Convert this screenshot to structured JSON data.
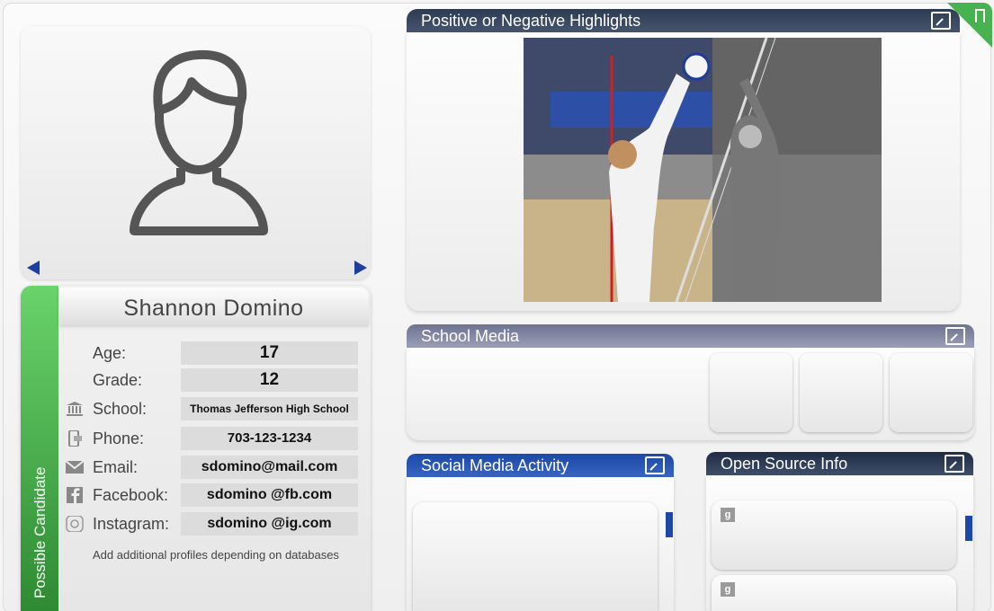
{
  "profile": {
    "name": "Shannon Domino",
    "status_tab": "Possible Candidate",
    "fields": [
      {
        "label": "Age:",
        "value": "17",
        "icon": null
      },
      {
        "label": "Grade:",
        "value": "12",
        "icon": null
      },
      {
        "label": "School:",
        "value": "Thomas Jefferson High School",
        "icon": "school-building-icon"
      },
      {
        "label": "Phone:",
        "value": "703-123-1234",
        "icon": "phone-icon"
      },
      {
        "label": "Email:",
        "value": "sdomino@mail.com",
        "icon": "email-envelope-icon"
      },
      {
        "label": "Facebook:",
        "value": "sdomino @fb.com",
        "icon": "facebook-icon"
      },
      {
        "label": "Instagram:",
        "value": "sdomino @ig.com",
        "icon": "instagram-icon"
      }
    ],
    "note": "Add additional profiles depending on databases"
  },
  "panels": {
    "highlights": {
      "title": "Positive or Negative Highlights"
    },
    "school_media": {
      "title": "School Media"
    },
    "social_media": {
      "title": "Social Media Activity"
    },
    "open_source": {
      "title": "Open Source Info"
    }
  },
  "colors": {
    "status_green": "#46b34f",
    "nav_arrow": "#1f3f9e",
    "highlights_header": "#2c3a52",
    "school_header": "#6c7290",
    "social_header": "#1c49a8",
    "osint_header": "#1f2c45"
  }
}
